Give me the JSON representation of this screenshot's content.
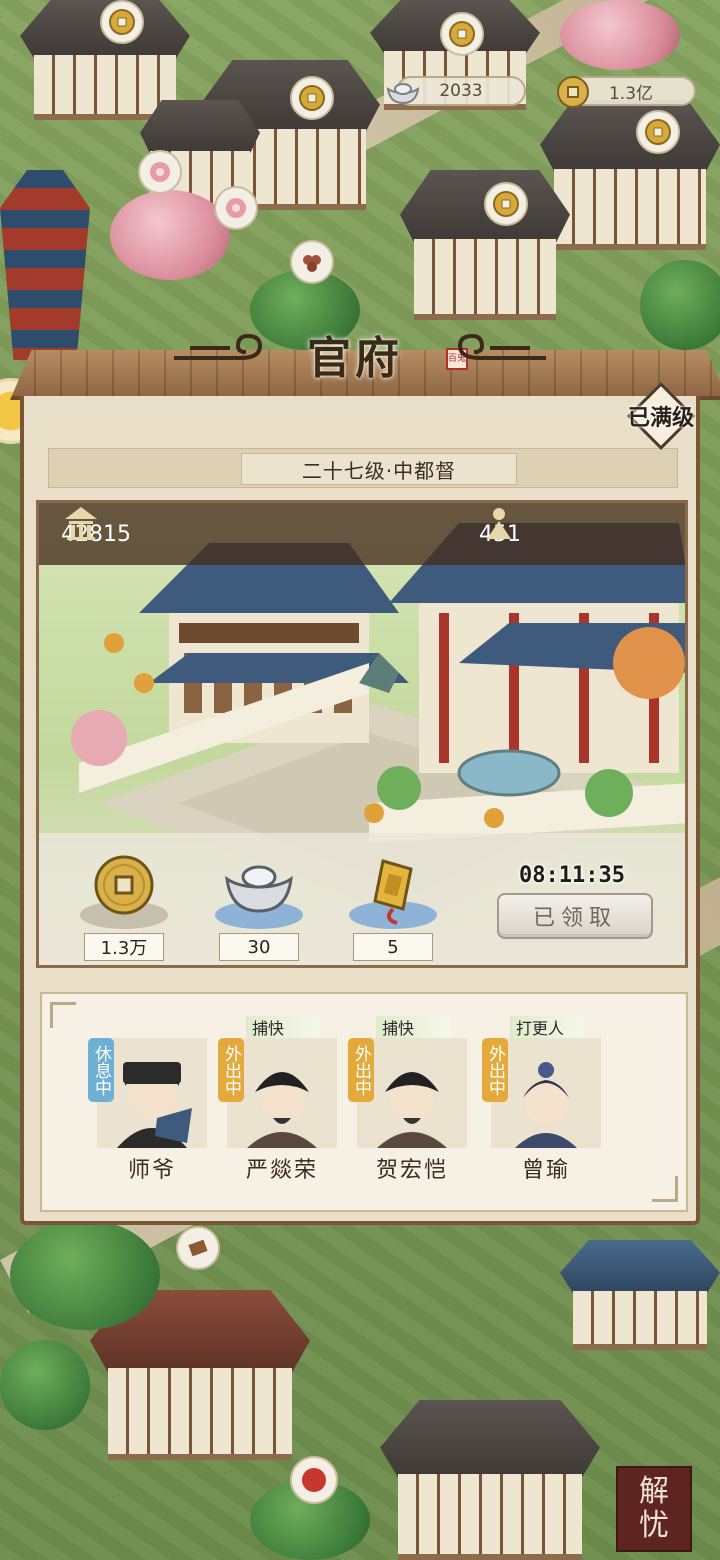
{
  "currency": {
    "silver": "2033",
    "coins": "1.3亿"
  },
  "panel": {
    "title": "官府",
    "seal": "百鬼",
    "level": "二十七级·中都督",
    "maxed": "已满级",
    "stats": {
      "prosperity": "42815",
      "population": "451"
    },
    "rewards": [
      {
        "icon": "copper-coin-icon",
        "qty": "1.3万"
      },
      {
        "icon": "silver-ingot-icon",
        "qty": "30"
      },
      {
        "icon": "token-icon",
        "qty": "5"
      }
    ],
    "timer": "08:11:35",
    "claim_button": "已领取",
    "staff": [
      {
        "name": "师爷",
        "status": "休息中",
        "role": ""
      },
      {
        "name": "严燚荣",
        "status": "外出中",
        "role": "捕快"
      },
      {
        "name": "贺宏恺",
        "status": "外出中",
        "role": "捕快"
      },
      {
        "name": "曾瑜",
        "status": "外出中",
        "role": "打更人"
      }
    ]
  },
  "side": {
    "stamp_button": [
      "解",
      "忧"
    ]
  },
  "colors": {
    "panel_bg": "#e9dfc8",
    "wood": "#7b5636",
    "rest_tag": "#6eb0d4",
    "out_tag": "#e3a93a"
  }
}
